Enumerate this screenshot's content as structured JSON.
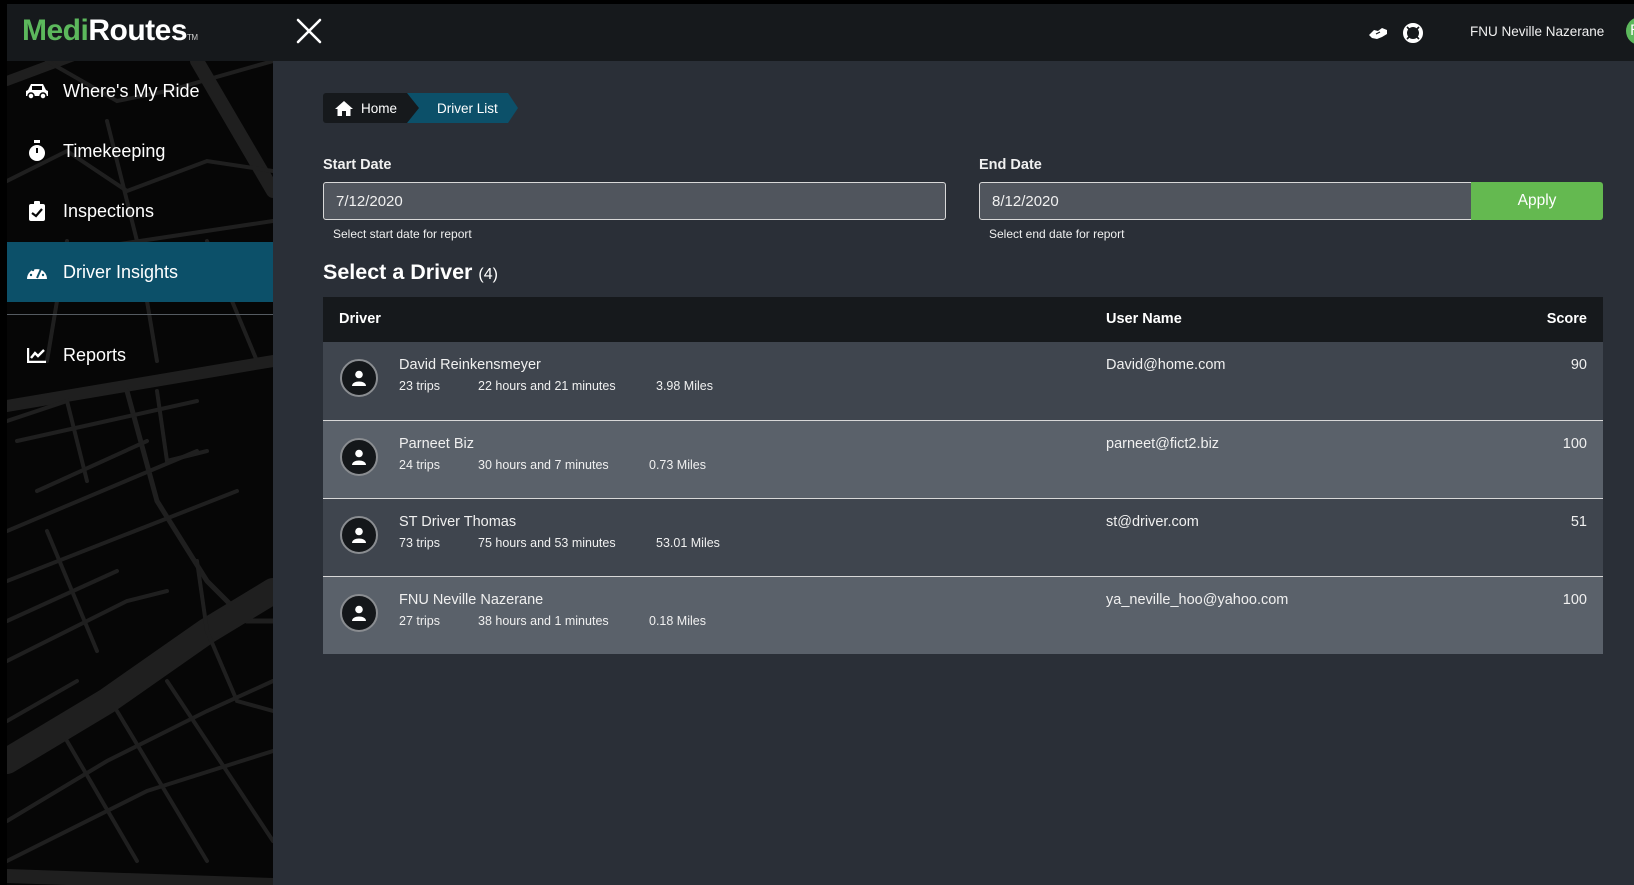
{
  "app": {
    "logo_part1": "Medi",
    "logo_part2": "Routes",
    "logo_tm": "TM"
  },
  "header": {
    "user_name": "FNU Neville Nazerane",
    "avatar_initial": "F",
    "icons": [
      "close-icon",
      "handshake-icon",
      "life-ring-icon"
    ]
  },
  "sidebar": {
    "items": [
      {
        "label": "Where's My Ride",
        "icon": "car-icon",
        "active": false
      },
      {
        "label": "Timekeeping",
        "icon": "stopwatch-icon",
        "active": false
      },
      {
        "label": "Inspections",
        "icon": "clipboard-check-icon",
        "active": false
      },
      {
        "label": "Driver Insights",
        "icon": "gauge-icon",
        "active": true
      },
      {
        "label": "Reports",
        "icon": "chart-line-icon",
        "active": false
      }
    ]
  },
  "breadcrumb": {
    "home": "Home",
    "current": "Driver List"
  },
  "filters": {
    "start_label": "Start Date",
    "start_value": "7/12/2020",
    "start_help": "Select start date for report",
    "end_label": "End Date",
    "end_value": "8/12/2020",
    "end_help": "Select end date for report",
    "apply_label": "Apply"
  },
  "section": {
    "title": "Select a Driver",
    "count": "(4)"
  },
  "table": {
    "headers": {
      "driver": "Driver",
      "username": "User Name",
      "score": "Score"
    },
    "rows": [
      {
        "name": "David Reinkensmeyer",
        "trips": "23 trips",
        "hours": "22 hours and 21 minutes",
        "miles": "3.98 Miles",
        "username": "David@home.com",
        "score": "90"
      },
      {
        "name": "Parneet Biz",
        "trips": "24 trips",
        "hours": "30 hours and 7 minutes",
        "miles": "0.73 Miles",
        "username": "parneet@fict2.biz",
        "score": "100"
      },
      {
        "name": "ST Driver Thomas",
        "trips": "73 trips",
        "hours": "75 hours and 53 minutes",
        "miles": "53.01 Miles",
        "username": "st@driver.com",
        "score": "51"
      },
      {
        "name": "FNU Neville Nazerane",
        "trips": "27 trips",
        "hours": "38 hours and 1 minutes",
        "miles": "0.18 Miles",
        "username": "ya_neville_hoo@yahoo.com",
        "score": "100"
      }
    ]
  },
  "colors": {
    "brand_green": "#5cb85c",
    "active_nav": "#0c5069",
    "apply_button": "#64b950",
    "header_bg": "#16191c",
    "main_bg": "#2a2f37"
  }
}
